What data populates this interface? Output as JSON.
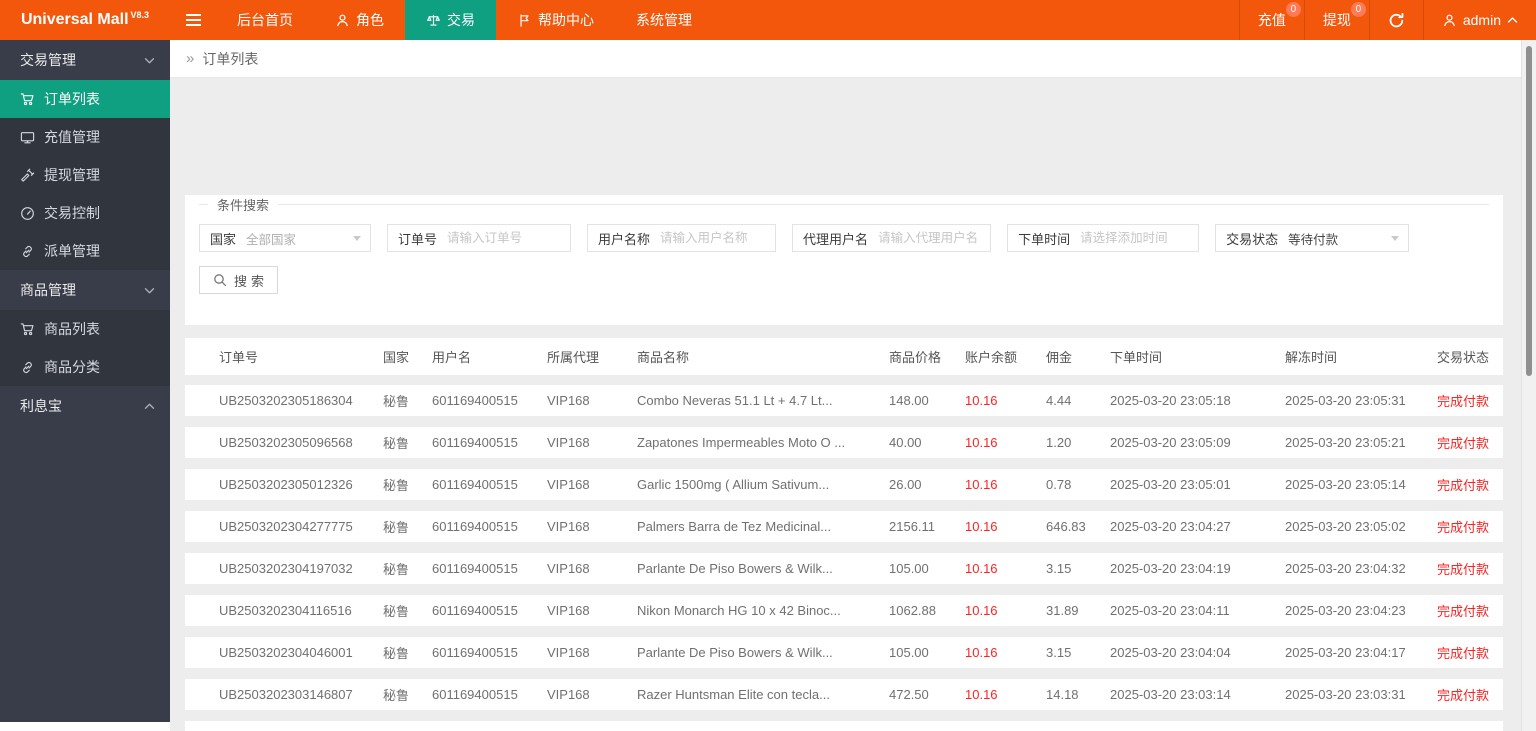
{
  "colors": {
    "topbar_orange": "#F2570C",
    "badge_red": "#FF7A55",
    "accent_green": "#0EA081",
    "sidebar_dark": "#393D49",
    "sidebar_submenu": "#31353E",
    "page_bg": "#EDEDED",
    "status_red": "#FF2222"
  },
  "topbar": {
    "logo": "Universal Mall",
    "version": "V8.3",
    "menu": [
      {
        "label": "后台首页",
        "icon": "",
        "active": false
      },
      {
        "label": "角色",
        "icon": "person",
        "active": false
      },
      {
        "label": "交易",
        "icon": "scales",
        "active": true
      },
      {
        "label": "帮助中心",
        "icon": "flag",
        "active": false
      },
      {
        "label": "系统管理",
        "icon": "",
        "active": false
      }
    ],
    "right": {
      "recharge_label": "充值",
      "recharge_badge": "0",
      "withdraw_label": "提现",
      "withdraw_badge": "0",
      "user": "admin"
    }
  },
  "sidebar": {
    "entries": [
      {
        "label": "交易管理",
        "is_group": true,
        "chevron": "down"
      },
      {
        "label": "订单列表",
        "icon": "cart",
        "active": true
      },
      {
        "label": "充值管理",
        "icon": "card"
      },
      {
        "label": "提现管理",
        "icon": "gavel"
      },
      {
        "label": "交易控制",
        "icon": "gauge"
      },
      {
        "label": "派单管理",
        "icon": "link"
      },
      {
        "label": "商品管理",
        "is_group": true,
        "chevron": "down"
      },
      {
        "label": "商品列表",
        "icon": "cart"
      },
      {
        "label": "商品分类",
        "icon": "link"
      },
      {
        "label": "利息宝",
        "is_group": true,
        "chevron": "up"
      }
    ]
  },
  "breadcrumb": {
    "symbol": "»",
    "title": "订单列表"
  },
  "search": {
    "legend": "条件搜索",
    "button_label": "搜索",
    "fields": [
      {
        "label": "国家",
        "control": "select",
        "value": "全部国家",
        "muted": true
      },
      {
        "label": "订单号",
        "control": "input",
        "placeholder": "请输入订单号"
      },
      {
        "label": "用户名称",
        "control": "input",
        "placeholder": "请输入用户名称"
      },
      {
        "label": "代理用户名",
        "control": "input",
        "placeholder": "请输入代理用户名"
      },
      {
        "label": "下单时间",
        "control": "input",
        "placeholder": "请选择添加时间"
      },
      {
        "label": "交易状态",
        "control": "select",
        "value": "等待付款",
        "muted": false
      }
    ]
  },
  "table": {
    "columns": [
      "订单号",
      "国家",
      "用户名",
      "所属代理",
      "商品名称",
      "商品价格",
      "账户余额",
      "佣金",
      "下单时间",
      "解冻时间",
      "交易状态"
    ],
    "rows": [
      {
        "order_no": "UB2503202305186304",
        "country": "秘鲁",
        "username": "601169400515",
        "agent": "VIP168",
        "product": "Combo Neveras 51.1 Lt + 4.7 Lt...",
        "price": "148.00",
        "balance": "10.16",
        "commission": "4.44",
        "order_time": "2025-03-20 23:05:18",
        "unfreeze_time": "2025-03-20 23:05:31",
        "status": "完成付款"
      },
      {
        "order_no": "UB2503202305096568",
        "country": "秘鲁",
        "username": "601169400515",
        "agent": "VIP168",
        "product": "Zapatones Impermeables Moto O ...",
        "price": "40.00",
        "balance": "10.16",
        "commission": "1.20",
        "order_time": "2025-03-20 23:05:09",
        "unfreeze_time": "2025-03-20 23:05:21",
        "status": "完成付款"
      },
      {
        "order_no": "UB2503202305012326",
        "country": "秘鲁",
        "username": "601169400515",
        "agent": "VIP168",
        "product": "Garlic 1500mg ( Allium Sativum...",
        "price": "26.00",
        "balance": "10.16",
        "commission": "0.78",
        "order_time": "2025-03-20 23:05:01",
        "unfreeze_time": "2025-03-20 23:05:14",
        "status": "完成付款"
      },
      {
        "order_no": "UB2503202304277775",
        "country": "秘鲁",
        "username": "601169400515",
        "agent": "VIP168",
        "product": "Palmers Barra de Tez Medicinal...",
        "price": "2156.11",
        "balance": "10.16",
        "commission": "646.83",
        "order_time": "2025-03-20 23:04:27",
        "unfreeze_time": "2025-03-20 23:05:02",
        "status": "完成付款"
      },
      {
        "order_no": "UB2503202304197032",
        "country": "秘鲁",
        "username": "601169400515",
        "agent": "VIP168",
        "product": "Parlante De Piso Bowers & Wilk...",
        "price": "105.00",
        "balance": "10.16",
        "commission": "3.15",
        "order_time": "2025-03-20 23:04:19",
        "unfreeze_time": "2025-03-20 23:04:32",
        "status": "完成付款"
      },
      {
        "order_no": "UB2503202304116516",
        "country": "秘鲁",
        "username": "601169400515",
        "agent": "VIP168",
        "product": "Nikon Monarch HG 10 x 42 Binoc...",
        "price": "1062.88",
        "balance": "10.16",
        "commission": "31.89",
        "order_time": "2025-03-20 23:04:11",
        "unfreeze_time": "2025-03-20 23:04:23",
        "status": "完成付款"
      },
      {
        "order_no": "UB2503202304046001",
        "country": "秘鲁",
        "username": "601169400515",
        "agent": "VIP168",
        "product": "Parlante De Piso Bowers & Wilk...",
        "price": "105.00",
        "balance": "10.16",
        "commission": "3.15",
        "order_time": "2025-03-20 23:04:04",
        "unfreeze_time": "2025-03-20 23:04:17",
        "status": "完成付款"
      },
      {
        "order_no": "UB2503202303146807",
        "country": "秘鲁",
        "username": "601169400515",
        "agent": "VIP168",
        "product": "Razer Huntsman Elite con tecla...",
        "price": "472.50",
        "balance": "10.16",
        "commission": "14.18",
        "order_time": "2025-03-20 23:03:14",
        "unfreeze_time": "2025-03-20 23:03:31",
        "status": "完成付款"
      }
    ]
  }
}
